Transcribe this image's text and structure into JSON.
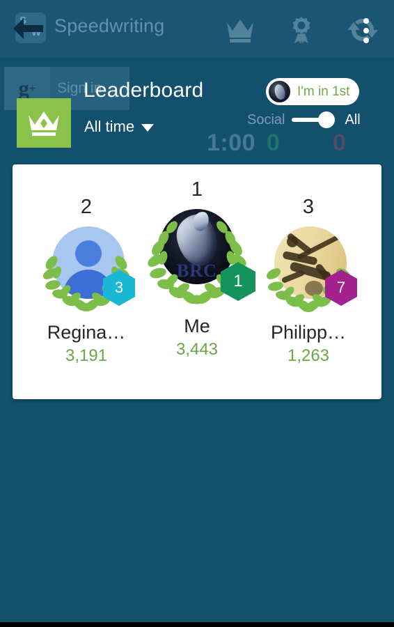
{
  "background_app": {
    "app_title": "Speedwriting",
    "app_icon_top": "S",
    "app_icon_bottom": "W",
    "back_icon": "back-arrow-icon",
    "signin_button_label": "Sign in",
    "gplus_mark": "g",
    "gplus_plus": "+",
    "timer": "1:00",
    "score_left": "0",
    "score_right": "0",
    "header_icons": [
      "crown-icon",
      "award-ribbon-icon",
      "refresh-icon",
      "overflow-menu-icon"
    ]
  },
  "overlay": {
    "badge_icon": "crown-icon",
    "badge_color": "#8BC34A",
    "title": "Leaderboard",
    "time_range": "All time",
    "time_range_caret": "chevron-down-icon",
    "me_chip": {
      "label": "I'm in 1st",
      "label_color": "#6DA845",
      "avatar": "my-avatar"
    },
    "filter": {
      "left_option": "Social",
      "right_option": "All",
      "selected": "All"
    }
  },
  "podium": [
    {
      "rank": "2",
      "name": "Regina…",
      "score": "3,191",
      "level": "3",
      "level_color": "#18B8D4",
      "avatar_type": "default-person-avatar"
    },
    {
      "rank": "1",
      "name": "Me",
      "score": "3,443",
      "level": "1",
      "level_color": "#13925B",
      "avatar_type": "dragon-avatar",
      "avatar_text": "BRC"
    },
    {
      "rank": "3",
      "name": "Philipp…",
      "score": "1,263",
      "level": "7",
      "level_color": "#A3228E",
      "avatar_type": "guitarist-sketch-avatar"
    }
  ],
  "colors": {
    "background": "#12506E",
    "card": "#FFFFFF",
    "score_green": "#6BA644",
    "accent_green": "#8BC34A"
  }
}
